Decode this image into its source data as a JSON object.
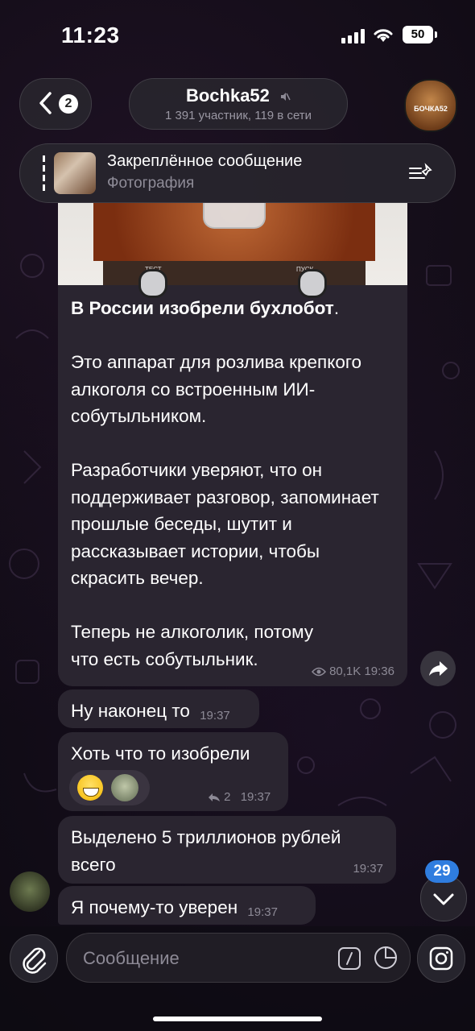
{
  "status": {
    "time": "11:23",
    "battery": "50"
  },
  "header": {
    "back_count": "2",
    "chat_name": "Bochka52",
    "chat_subtitle": "1 391 участник, 119 в сети",
    "avatar_label": "БОЧКА52"
  },
  "pinned": {
    "title": "Закреплённое сообщение",
    "subtitle": "Фотография"
  },
  "post": {
    "headline": "В России изобрели бухлобот",
    "headline_tail": ".",
    "paragraphs": [
      "Это аппарат для розлива крепкого алкоголя со встроенным ИИ-собутыльником.",
      "Разработчики уверяют, что он поддерживает разговор, запоминает прошлые беседы, шутит и рассказывает истории, чтобы скрасить вечер.",
      "Теперь не алкоголик, потому что есть собутыльник."
    ],
    "views": "80,1K",
    "time": "19:36",
    "photo_labels": {
      "left": "ТЕСТ",
      "right": "ПУСК"
    }
  },
  "messages": [
    {
      "text": "Ну наконец то",
      "time": "19:37"
    },
    {
      "text": "Хоть что то изобрели",
      "time": "19:37",
      "replies": "2"
    },
    {
      "text_line1": "Выделено 5 триллионов рублей",
      "text_line2": "всего",
      "time": "19:37"
    },
    {
      "text": "Я почему-то уверен",
      "time": "19:37"
    }
  ],
  "scroll_badge": "29",
  "composer": {
    "placeholder": "Сообщение"
  },
  "colors": {
    "bubble": "#2a2530",
    "accent": "#2f7ddf",
    "meta": "#8d8a96"
  }
}
